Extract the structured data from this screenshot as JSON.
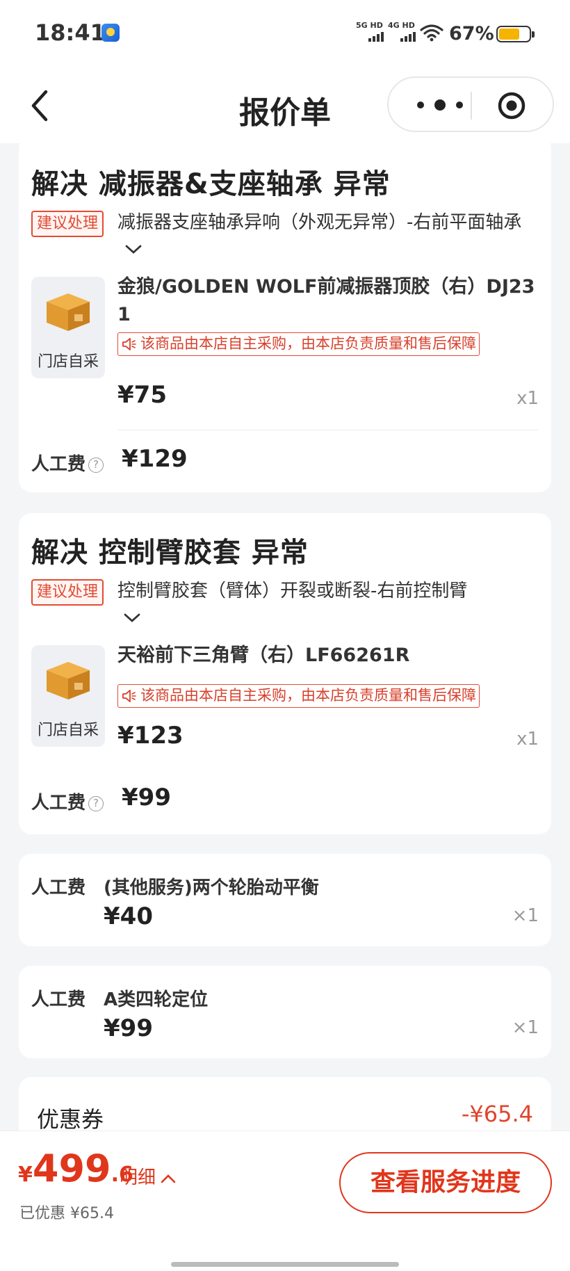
{
  "status_bar": {
    "time": "18:41",
    "net1": "5G HD",
    "net2": "4G HD",
    "battery": "67%"
  },
  "nav": {
    "title": "报价单"
  },
  "cards": [
    {
      "title": "解决 减振器&支座轴承 异常",
      "tag": "建议处理",
      "issue": "减振器支座轴承异响（外观无异常）-右前平面轴承",
      "thumb_label": "门店自采",
      "product": "金狼/GOLDEN WOLF前减振器顶胶（右）DJ231",
      "notice": "该商品由本店自主采购，由本店负责质量和售后保障",
      "price": "¥75",
      "qty": "x1",
      "labor_label": "人工费",
      "labor_price": "¥129"
    },
    {
      "title": "解决 控制臂胶套 异常",
      "tag": "建议处理",
      "issue": "控制臂胶套（臂体）开裂或断裂-右前控制臂",
      "thumb_label": "门店自采",
      "product": "天裕前下三角臂（右）LF66261R",
      "notice": "该商品由本店自主采购，由本店负责质量和售后保障",
      "price": "¥123",
      "qty": "x1",
      "labor_label": "人工费",
      "labor_price": "¥99"
    }
  ],
  "services": [
    {
      "label": "人工费",
      "name": "(其他服务)两个轮胎动平衡",
      "price": "¥40",
      "qty": "×1"
    },
    {
      "label": "人工费",
      "name": "A类四轮定位",
      "price": "¥99",
      "qty": "×1"
    }
  ],
  "coupon": {
    "label": "优惠券",
    "value": "-¥65.4"
  },
  "bottom": {
    "currency": "¥",
    "total_int": "499",
    "total_dec": ".6",
    "detail_label": "明细",
    "saved": "已优惠 ¥65.4",
    "progress_button": "查看服务进度"
  },
  "colors": {
    "accent": "#e0361c",
    "tag_red": "#e24b33",
    "background": "#f4f5f7"
  }
}
